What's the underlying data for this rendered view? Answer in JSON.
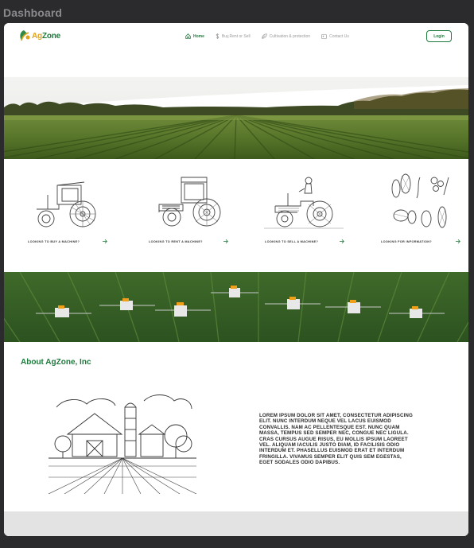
{
  "page": {
    "label": "Dashboard"
  },
  "brand": {
    "name_prefix": "Ag",
    "name_suffix": "Zone",
    "accent": "#1f7a3d",
    "gold": "#e0a21a"
  },
  "nav": {
    "items": [
      {
        "label": "Home",
        "icon": "home-icon",
        "active": true
      },
      {
        "label": "Buy,Rent or Sell",
        "icon": "dollar-icon",
        "active": false
      },
      {
        "label": "Cultivation & protection",
        "icon": "leaf-icon",
        "active": false
      },
      {
        "label": "Contact Us",
        "icon": "contact-card-icon",
        "active": false
      }
    ],
    "login_label": "Login"
  },
  "cards": [
    {
      "label": "LOOKING TO BUY A MACHINE?",
      "icon": "vintage-tractor-sketch"
    },
    {
      "label": "LOOKING TO RENT A MACHINE?",
      "icon": "modern-tractor-sketch"
    },
    {
      "label": "LOOKING TO SELL A MACHINE?",
      "icon": "farmer-on-tractor-sketch"
    },
    {
      "label": "LOOKING FOR INFORMATION?",
      "icon": "crops-sketch"
    }
  ],
  "about": {
    "title": "About AgZone, Inc",
    "body": "Lorem ipsum dolor sit amet, consectetur adipiscing elit. Nunc interdum neque vel lacus euismod convallis. Nam ac pellentesque est. Nunc quam massa, tempus sed semper nec, congue nec ligula. Cras cursus augue risus, eu mollis ipsum laoreet vel. Aliquam iaculis justo diam, id facilisis odio interdum et. Phasellus euismod erat et interdum fringilla. Vivamus semper elit quis sem egestas, eget sodales odio dapibus."
  }
}
